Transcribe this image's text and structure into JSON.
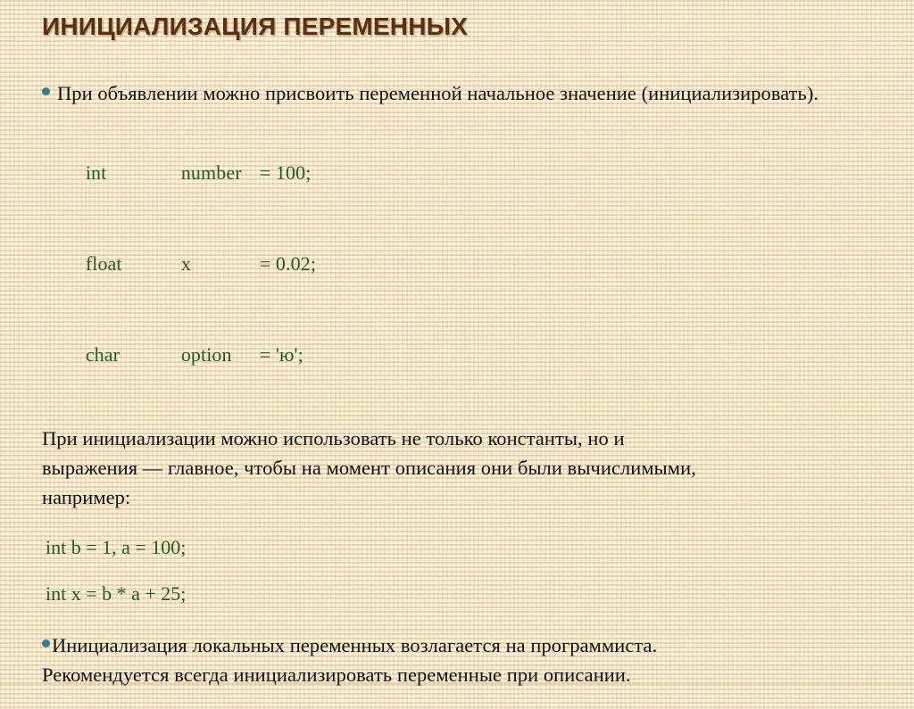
{
  "slide": {
    "title": "ИНИЦИАЛИЗАЦИЯ ПЕРЕМЕННЫХ",
    "background_color": "#f3e4c6",
    "title_color": "#5a2f12",
    "body_text_color": "#111111",
    "code_color": "#1f5e21",
    "bullet_color": "#2f7f93"
  },
  "content": {
    "paragraph_1": "При объявлении можно присвоить переменной начальное значение (инициализировать).",
    "code_block_1": [
      {
        "type": "int",
        "name": "number",
        "assign": "= 100;"
      },
      {
        "type": "float",
        "name": "x",
        "assign": "= 0.02;"
      },
      {
        "type": "char",
        "name": "option",
        "assign": "= 'ю';"
      }
    ],
    "paragraph_2_line_1": " При инициализации можно использовать не только константы, но и",
    "paragraph_2_line_2": "выражения — главное, чтобы на момент описания они были вычислимыми,",
    "paragraph_2_line_3": "например:",
    "code_line_1": "int b = 1, a = 100;",
    "code_line_2": "int x = b * a + 25;",
    "paragraph_3_line_1": "Инициализация локальных  переменных возлагается на программиста.",
    "paragraph_3_line_2": "Рекомендуется всегда инициализировать переменные при описании."
  }
}
